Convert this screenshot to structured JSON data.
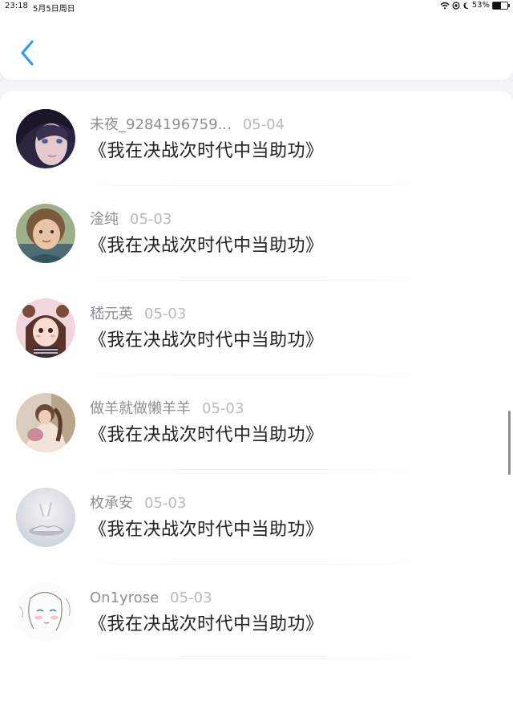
{
  "status_bar": {
    "time": "23:18",
    "date": "5月5日周日",
    "battery": "53%",
    "battery_level": 0.53
  },
  "nav": {
    "back_icon": "chevron-left-icon",
    "accent_color": "#2a9df4"
  },
  "comments": [
    {
      "user": "未夜_9284196759...",
      "date": "05-04",
      "text": "《我在决战次时代中当助功》"
    },
    {
      "user": "淦纯",
      "date": "05-03",
      "text": "《我在决战次时代中当助功》"
    },
    {
      "user": "嵇元英",
      "date": "05-03",
      "text": "《我在决战次时代中当助功》"
    },
    {
      "user": "做羊就做懒羊羊",
      "date": "05-03",
      "text": "《我在决战次时代中当助功》"
    },
    {
      "user": "枚承安",
      "date": "05-03",
      "text": "《我在决战次时代中当助功》"
    },
    {
      "user": "On1yrose",
      "date": "05-03",
      "text": "《我在决战次时代中当助功》"
    }
  ]
}
